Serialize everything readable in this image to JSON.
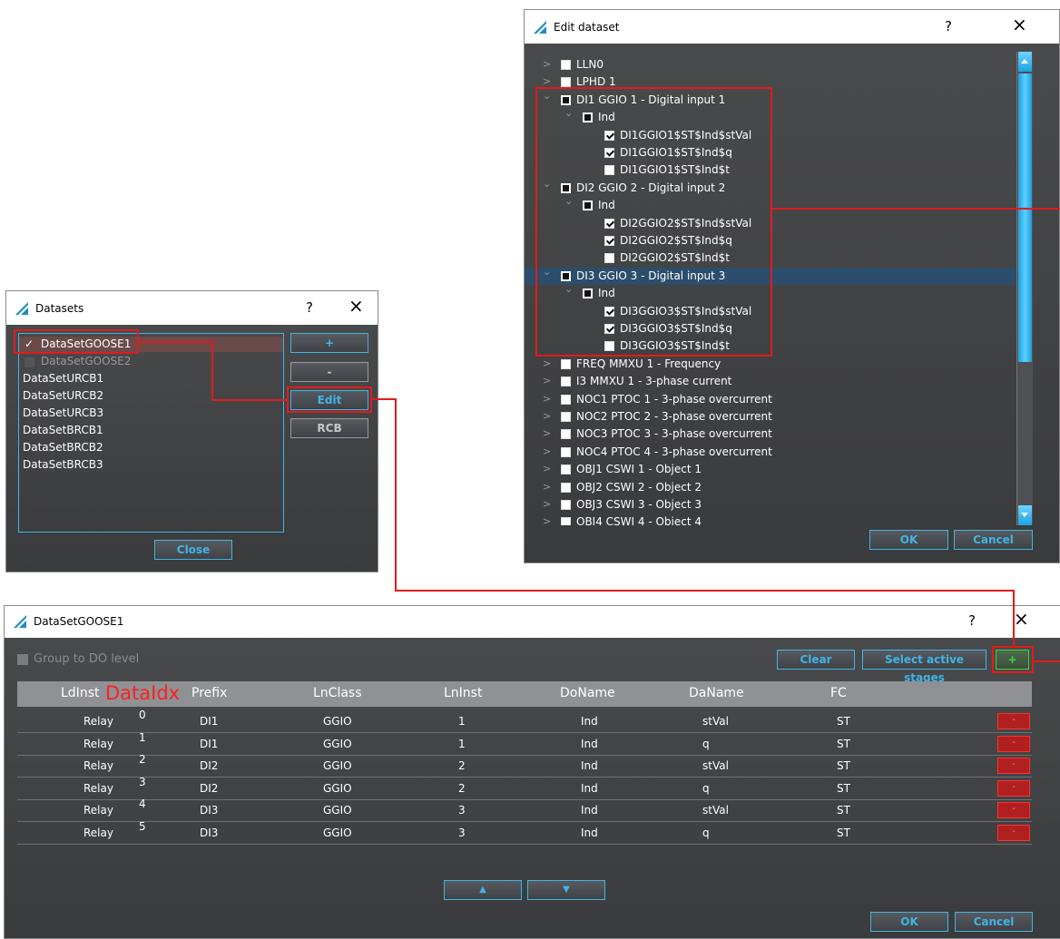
{
  "edit_dataset": {
    "title": "Edit dataset",
    "help": "?",
    "close": "×",
    "tree": [
      {
        "chev": ">",
        "cb": "white",
        "label": "LLN0"
      },
      {
        "chev": ">",
        "cb": "white",
        "label": "LPHD 1"
      },
      {
        "chev": "⌄",
        "cb": "dark",
        "label": "DI1 GGIO 1 - Digital input 1"
      },
      {
        "chev": "⌄",
        "cb": "dark",
        "label": "Ind"
      },
      {
        "chev": "",
        "cb": "checked",
        "label": "DI1GGIO1$ST$Ind$stVal"
      },
      {
        "chev": "",
        "cb": "checked",
        "label": "DI1GGIO1$ST$Ind$q"
      },
      {
        "chev": "",
        "cb": "white",
        "label": "DI1GGIO1$ST$Ind$t"
      },
      {
        "chev": "⌄",
        "cb": "dark",
        "label": "DI2 GGIO 2 - Digital input 2"
      },
      {
        "chev": "⌄",
        "cb": "dark",
        "label": "Ind"
      },
      {
        "chev": "",
        "cb": "checked",
        "label": "DI2GGIO2$ST$Ind$stVal"
      },
      {
        "chev": "",
        "cb": "checked",
        "label": "DI2GGIO2$ST$Ind$q"
      },
      {
        "chev": "",
        "cb": "white",
        "label": "DI2GGIO2$ST$Ind$t"
      },
      {
        "chev": "⌄",
        "cb": "dark",
        "label": "DI3 GGIO 3 - Digital input 3"
      },
      {
        "chev": "⌄",
        "cb": "dark",
        "label": "Ind"
      },
      {
        "chev": "",
        "cb": "checked",
        "label": "DI3GGIO3$ST$Ind$stVal"
      },
      {
        "chev": "",
        "cb": "checked",
        "label": "DI3GGIO3$ST$Ind$q"
      },
      {
        "chev": "",
        "cb": "white",
        "label": "DI3GGIO3$ST$Ind$t"
      },
      {
        "chev": ">",
        "cb": "white",
        "label": "FREQ MMXU 1 - Frequency"
      },
      {
        "chev": ">",
        "cb": "white",
        "label": "I3 MMXU 1 - 3-phase current"
      },
      {
        "chev": ">",
        "cb": "white",
        "label": "NOC1 PTOC 1 - 3-phase overcurrent"
      },
      {
        "chev": ">",
        "cb": "white",
        "label": "NOC2 PTOC 2 - 3-phase overcurrent"
      },
      {
        "chev": ">",
        "cb": "white",
        "label": "NOC3 PTOC 3 - 3-phase overcurrent"
      },
      {
        "chev": ">",
        "cb": "white",
        "label": "NOC4 PTOC 4 - 3-phase overcurrent"
      },
      {
        "chev": ">",
        "cb": "white",
        "label": "OBJ1 CSWI 1 - Object 1"
      },
      {
        "chev": ">",
        "cb": "white",
        "label": "OBJ2 CSWI 2 - Object 2"
      },
      {
        "chev": ">",
        "cb": "white",
        "label": "OBJ3 CSWI 3 - Object 3"
      },
      {
        "chev": ">",
        "cb": "white",
        "label": "OBJ4 CSWI 4 - Object 4"
      }
    ],
    "ok": "OK",
    "cancel": "Cancel",
    "highlight_color": "#2c4d6b"
  },
  "datasets": {
    "title": "Datasets",
    "help": "?",
    "close": "×",
    "items": [
      "DataSetGOOSE1",
      "DataSetGOOSE2",
      "DataSetURCB1",
      "DataSetURCB2",
      "DataSetURCB3",
      "DataSetBRCB1",
      "DataSetBRCB2",
      "DataSetBRCB3"
    ],
    "check_mark": "✓",
    "add": "+",
    "remove": "-",
    "edit": "Edit",
    "rcb": "RCB",
    "close_button": "Close"
  },
  "goose": {
    "title": "DataSetGOOSE1",
    "help": "?",
    "close": "×",
    "group_label": "Group to DO level",
    "clear": "Clear",
    "select_active": "Select active stages",
    "add": "+",
    "columns": [
      "LdInst",
      "Prefix",
      "LnClass",
      "LnInst",
      "DoName",
      "DaName",
      "FC"
    ],
    "dataidx_label": "DataIdx",
    "rows": [
      {
        "idx": "0",
        "ldinst": "Relay",
        "prefix": "DI1",
        "lnclass": "GGIO",
        "lninst": "1",
        "doname": "Ind",
        "daname": "stVal",
        "fc": "ST",
        "remove": "-"
      },
      {
        "idx": "1",
        "ldinst": "Relay",
        "prefix": "DI1",
        "lnclass": "GGIO",
        "lninst": "1",
        "doname": "Ind",
        "daname": "q",
        "fc": "ST",
        "remove": "-"
      },
      {
        "idx": "2",
        "ldinst": "Relay",
        "prefix": "DI2",
        "lnclass": "GGIO",
        "lninst": "2",
        "doname": "Ind",
        "daname": "stVal",
        "fc": "ST",
        "remove": "-"
      },
      {
        "idx": "3",
        "ldinst": "Relay",
        "prefix": "DI2",
        "lnclass": "GGIO",
        "lninst": "2",
        "doname": "Ind",
        "daname": "q",
        "fc": "ST",
        "remove": "-"
      },
      {
        "idx": "4",
        "ldinst": "Relay",
        "prefix": "DI3",
        "lnclass": "GGIO",
        "lninst": "3",
        "doname": "Ind",
        "daname": "stVal",
        "fc": "ST",
        "remove": "-"
      },
      {
        "idx": "5",
        "ldinst": "Relay",
        "prefix": "DI3",
        "lnclass": "GGIO",
        "lninst": "3",
        "doname": "Ind",
        "daname": "q",
        "fc": "ST",
        "remove": "-"
      }
    ],
    "up": "▲",
    "down": "▼",
    "ok": "OK",
    "cancel": "Cancel"
  },
  "colors": {
    "accent": "#3fb5e6",
    "annotation": "#e21b1b",
    "add_green": "#39d839"
  }
}
